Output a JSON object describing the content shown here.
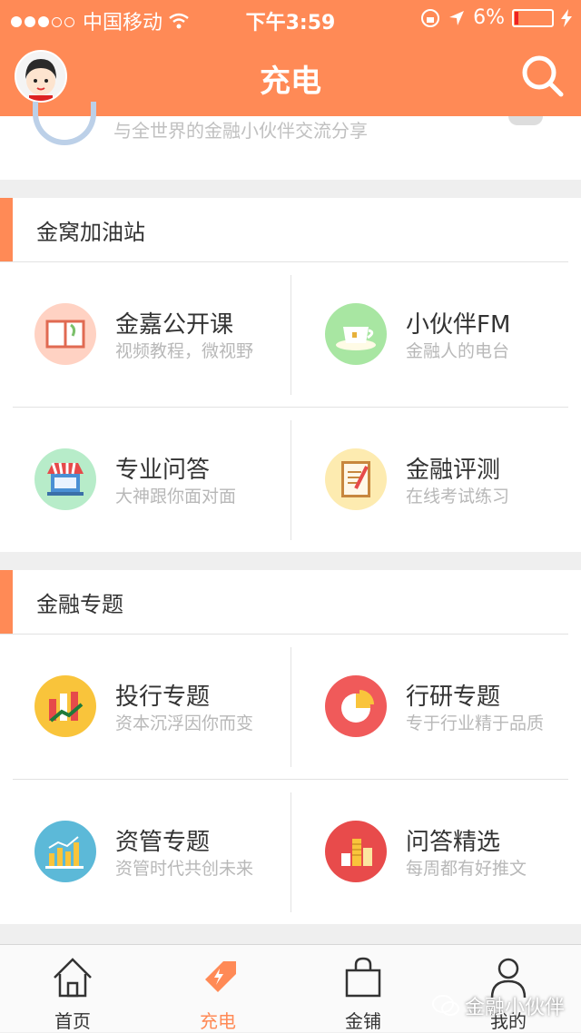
{
  "status": {
    "carrier": "中国移动",
    "time": "下午3:59",
    "battery": "6%"
  },
  "header": {
    "title": "充电",
    "search_icon": "search-icon",
    "avatar": "user-avatar"
  },
  "top_card": {
    "subtitle": "与全世界的金融小伙伴交流分享"
  },
  "sections": [
    {
      "title": "金窝加油站",
      "items": [
        {
          "name": "金嘉公开课",
          "desc": "视频教程，微视野",
          "icon": "book-icon",
          "color": "#ffcfc0"
        },
        {
          "name": "小伙伴FM",
          "desc": "金融人的电台",
          "icon": "teacup-icon",
          "color": "#a8e6a2"
        },
        {
          "name": "专业问答",
          "desc": "大神跟你面对面",
          "icon": "shop-icon",
          "color": "#b7ecc9"
        },
        {
          "name": "金融评测",
          "desc": "在线考试练习",
          "icon": "notebook-icon",
          "color": "#fdebb0"
        }
      ]
    },
    {
      "title": "金融专题",
      "items": [
        {
          "name": "投行专题",
          "desc": "资本沉浮因你而变",
          "icon": "rising-chart-icon",
          "color": "#f9c43b"
        },
        {
          "name": "行研专题",
          "desc": "专于行业精于品质",
          "icon": "pie-chart-icon",
          "color": "#f05a5a"
        },
        {
          "name": "资管专题",
          "desc": "资管时代共创未来",
          "icon": "bar-chart-icon",
          "color": "#5cb9d8"
        },
        {
          "name": "问答精选",
          "desc": "每周都有好推文",
          "icon": "coins-icon",
          "color": "#e84b4b"
        }
      ]
    }
  ],
  "tabs": [
    {
      "label": "首页",
      "icon": "home-icon"
    },
    {
      "label": "充电",
      "icon": "lightning-tag-icon",
      "active": true
    },
    {
      "label": "金铺",
      "icon": "shopping-bag-icon"
    },
    {
      "label": "我的",
      "icon": "person-icon"
    }
  ],
  "watermark": {
    "text": "金融小伙伴"
  },
  "colors": {
    "accent": "#ff8a56"
  }
}
